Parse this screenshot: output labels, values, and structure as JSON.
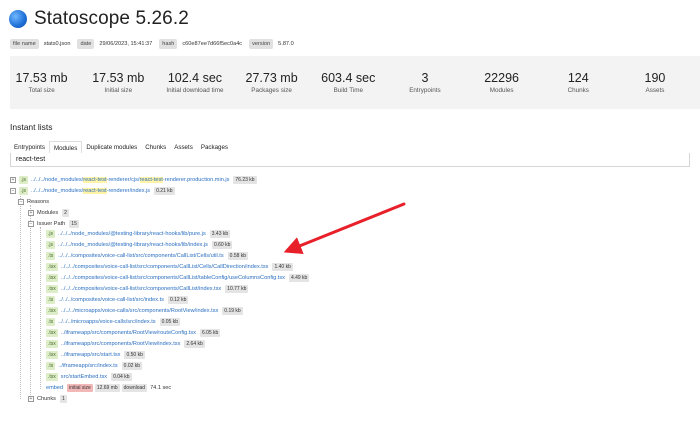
{
  "app": {
    "title": "Statoscope 5.26.2"
  },
  "meta": [
    {
      "key": "file name",
      "value": "stats0.json"
    },
    {
      "key": "date",
      "value": "29/06/2023, 15:41:37"
    },
    {
      "key": "hash",
      "value": "c60e87ee7d66f5ec0a4c"
    },
    {
      "key": "version",
      "value": "5.87.0"
    }
  ],
  "stats": [
    {
      "value": "17.53 mb",
      "label": "Total size"
    },
    {
      "value": "17.53 mb",
      "label": "Initial size"
    },
    {
      "value": "102.4 sec",
      "label": "Initial download time"
    },
    {
      "value": "27.73 mb",
      "label": "Packages size"
    },
    {
      "value": "603.4 sec",
      "label": "Build Time"
    },
    {
      "value": "3",
      "label": "Entrypoints"
    },
    {
      "value": "22296",
      "label": "Modules"
    },
    {
      "value": "124",
      "label": "Chunks"
    },
    {
      "value": "190",
      "label": "Assets"
    }
  ],
  "section": {
    "title": "Instant lists"
  },
  "tabs": [
    "Entrypoints",
    "Modules",
    "Duplicate modules",
    "Chunks",
    "Assets",
    "Packages"
  ],
  "active_tab": "Modules",
  "search": {
    "value": "react-test"
  },
  "tree": {
    "row1": {
      "ext": ".js",
      "pre": "../../../node_modules/",
      "hl1": "react-test",
      "mid": "-renderer/cjs/",
      "hl2": "react-test",
      "post": "-renderer.production.min.js",
      "size": "76.23 kb"
    },
    "row2": {
      "ext": ".js",
      "pre": "../../../node_modules/",
      "hl1": "react-test",
      "post": "-renderer/index.js",
      "size": "0.21 kb"
    },
    "reasons": "Reasons",
    "modules": {
      "label": "Modules",
      "count": "2"
    },
    "issuer": {
      "label": "Issuer Path",
      "count": "15"
    },
    "issuer_items": [
      {
        "ext": ".js",
        "path": "../../../node_modules/@testing-library/react-hooks/lib/pure.js",
        "size": "3.43 kb"
      },
      {
        "ext": ".js",
        "path": "../../../node_modules/@testing-library/react-hooks/lib/index.js",
        "size": "0.60 kb"
      },
      {
        "ext": ".ts",
        "path": "../../../composites/voice-call-list/src/components/CallList/Cells/util.ts",
        "size": "0.58 kb"
      },
      {
        "ext": ".tsx",
        "path": "../../../composites/voice-call-list/src/components/CallList/Cells/CallDirection/index.tsx",
        "size": "1.40 kb"
      },
      {
        "ext": ".tsx",
        "path": "../../../composites/voice-call-list/src/components/CallList/tableConfig/useColumnsConfig.tsx",
        "size": "4.49 kb"
      },
      {
        "ext": ".tsx",
        "path": "../../../composites/voice-call-list/src/components/CallList/index.tsx",
        "size": "10.77 kb"
      },
      {
        "ext": ".ts",
        "path": "../../../composites/voice-call-list/src/index.ts",
        "size": "0.12 kb"
      },
      {
        "ext": ".tsx",
        "path": "../../../microapps/voice-calls/src/components/RootView/index.tsx",
        "size": "0.19 kb"
      },
      {
        "ext": ".ts",
        "path": "../../../microapps/voice-calls/src/index.ts",
        "size": "0.05 kb"
      },
      {
        "ext": ".tsx",
        "path": "../iframeapp/src/components/RootView/routeConfig.tsx",
        "size": "6.05 kb"
      },
      {
        "ext": ".tsx",
        "path": "../iframeapp/src/components/RootView/index.tsx",
        "size": "2.64 kb"
      },
      {
        "ext": ".tsx",
        "path": "../iframeapp/src/start.tsx",
        "size": "0.50 kb"
      },
      {
        "ext": ".ts",
        "path": "../iframeapp/src/index.ts",
        "size": "0.02 kb"
      },
      {
        "ext": ".tsx",
        "path": "src/startEmbed.tsx",
        "size": "0.04 kb"
      }
    ],
    "embed": {
      "name": "embed",
      "initial_label": "initial size",
      "initial_value": "12.69 mb",
      "download_label": "download",
      "download_value": "74.1 sec"
    },
    "chunks": {
      "label": "Chunks",
      "count": "1"
    }
  },
  "colors": {
    "accent_arrow": "#e8202a",
    "link": "#2a6fc0",
    "highlight": "#fff3a6"
  }
}
